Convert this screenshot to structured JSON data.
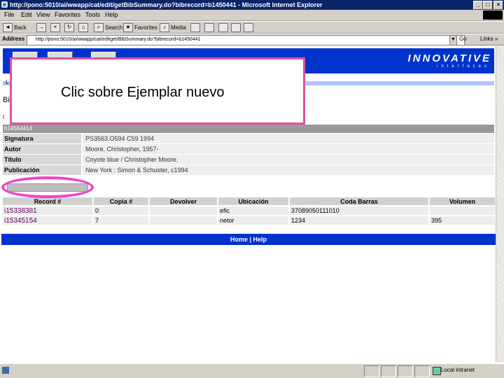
{
  "window": {
    "title": "http://pono:5010/ai/wwapp/cat/edit/getBibSummary.do?bibrecord=b1450441 - Microsoft Internet Explorer",
    "min": "_",
    "max": "□",
    "close": "×"
  },
  "menu": [
    "File",
    "Edit",
    "View",
    "Favorites",
    "Tools",
    "Help"
  ],
  "toolbar": {
    "back": "Back",
    "forward": "→",
    "stop": "×",
    "refresh": "↻",
    "home": "⌂",
    "search": "Search",
    "favorites": "Favorites",
    "media": "Media"
  },
  "address": {
    "label": "Address",
    "url": "http://pono:5010/ai/wwapp/cat/editget/BibSummary.do?bibrecord=b1450441",
    "go": "Go",
    "links": "Links »"
  },
  "header": {
    "brand": "INNOVATIVE",
    "brand_sub": "interfaces"
  },
  "page": {
    "stripe_letter": "L",
    "bib_letter": "Bi",
    "small_l": "l"
  },
  "record": {
    "id": "b14564414",
    "fields": [
      {
        "label": "Signatura",
        "value": "PS3563.O594 C59 1994"
      },
      {
        "label": "Autor",
        "value": "Moore, Christopher, 1957-"
      },
      {
        "label": "Título",
        "value": "Coyote blue / Christopher Moore."
      },
      {
        "label": "Publicación",
        "value": "New York : Simon & Schuster, c1994"
      }
    ]
  },
  "items": {
    "headers": [
      "Record #",
      "Copia #",
      "Devolver",
      "Ubicación",
      "Coda Barras",
      "Volumen"
    ],
    "rows": [
      {
        "record": "i15338381",
        "copy": "0",
        "return": "",
        "location": "efic",
        "barcode": "37089050111010",
        "volume": ""
      },
      {
        "record": "i15345154",
        "copy": "7",
        "return": "",
        "location": "netor",
        "barcode": "1234",
        "volume": "395"
      }
    ]
  },
  "footer": {
    "text": "Home | Help"
  },
  "status": {
    "zone": "Local intranet"
  },
  "annotation": {
    "text": "Clic sobre Ejemplar nuevo"
  }
}
